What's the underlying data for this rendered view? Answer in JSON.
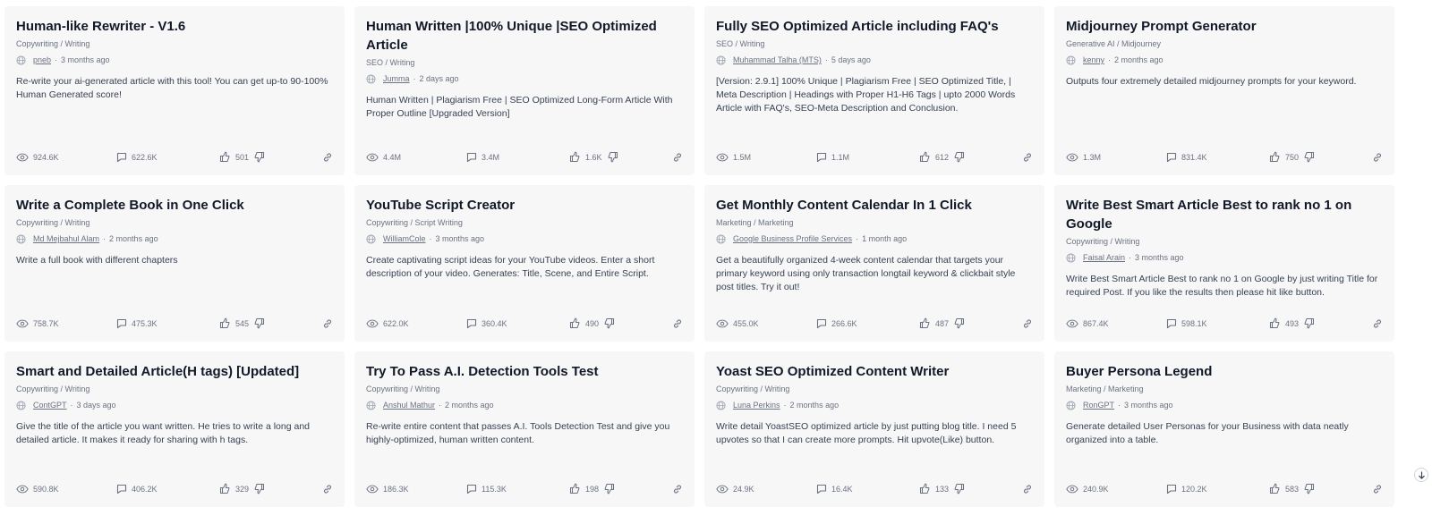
{
  "cards": [
    {
      "title": "Human-like Rewriter - V1.6",
      "category": "Copywriting / Writing",
      "author": "pneb",
      "age": "3 months ago",
      "description": "Re-write your ai-generated article with this tool! You can get up-to 90-100% Human Generated score!",
      "views": "924.6K",
      "comments": "622.6K",
      "likes": "501"
    },
    {
      "title": "Human Written |100% Unique |SEO Optimized Article",
      "category": "SEO / Writing",
      "author": "Jumma",
      "age": "2 days ago",
      "description": "Human Written | Plagiarism Free | SEO Optimized Long-Form Article With Proper Outline [Upgraded Version]",
      "views": "4.4M",
      "comments": "3.4M",
      "likes": "1.6K"
    },
    {
      "title": "Fully SEO Optimized Article including FAQ's",
      "category": "SEO / Writing",
      "author": "Muhammad Talha (MTS)",
      "age": "5 days ago",
      "description": "[Version: 2.9.1] 100% Unique | Plagiarism Free | SEO Optimized Title, | Meta Description | Headings with Proper H1-H6 Tags | upto 2000 Words Article with FAQ's, SEO-Meta Description and Conclusion.",
      "views": "1.5M",
      "comments": "1.1M",
      "likes": "612"
    },
    {
      "title": "Midjourney Prompt Generator",
      "category": "Generative AI / Midjourney",
      "author": "kenny",
      "age": "2 months ago",
      "description": "Outputs four extremely detailed midjourney prompts for your keyword.",
      "views": "1.3M",
      "comments": "831.4K",
      "likes": "750"
    },
    {
      "title": "Write a Complete Book in One Click",
      "category": "Copywriting / Writing",
      "author": "Md Mejbahul Alam",
      "age": "2 months ago",
      "description": "Write a full book with different chapters",
      "views": "758.7K",
      "comments": "475.3K",
      "likes": "545"
    },
    {
      "title": "YouTube Script Creator",
      "category": "Copywriting / Script Writing",
      "author": "WilliamCole",
      "age": "3 months ago",
      "description": "Create captivating script ideas for your YouTube videos. Enter a short description of your video. Generates: Title, Scene, and Entire Script.",
      "views": "622.0K",
      "comments": "360.4K",
      "likes": "490"
    },
    {
      "title": "Get Monthly Content Calendar In 1 Click",
      "category": "Marketing / Marketing",
      "author": "Google Business Profile Services",
      "age": "1 month ago",
      "description": "Get a beautifully organized 4-week content calendar that targets your primary keyword using only transaction longtail keyword & clickbait style post titles. Try it out!",
      "views": "455.0K",
      "comments": "266.6K",
      "likes": "487"
    },
    {
      "title": "Write Best Smart Article Best to rank no 1 on Google",
      "category": "Copywriting / Writing",
      "author": "Faisal Arain",
      "age": "3 months ago",
      "description": "Write Best Smart Article Best to rank no 1 on Google by just writing Title for required Post. If you like the results then please hit like button.",
      "views": "867.4K",
      "comments": "598.1K",
      "likes": "493"
    },
    {
      "title": "Smart and Detailed Article(H tags) [Updated]",
      "category": "Copywriting / Writing",
      "author": "ContGPT",
      "age": "3 days ago",
      "description": "Give the title of the article you want written. He tries to write a long and detailed article. It makes it ready for sharing with h tags.",
      "views": "590.8K",
      "comments": "406.2K",
      "likes": "329"
    },
    {
      "title": "Try To Pass A.I. Detection Tools Test",
      "category": "Copywriting / Writing",
      "author": "Anshul Mathur",
      "age": "2 months ago",
      "description": "Re-write entire content that passes A.I. Tools Detection Test and give you highly-optimized, human written content.",
      "views": "186.3K",
      "comments": "115.3K",
      "likes": "198"
    },
    {
      "title": "Yoast SEO Optimized Content Writer",
      "category": "Copywriting / Writing",
      "author": "Luna Perkins",
      "age": "2 months ago",
      "description": "Write detail YoastSEO optimized article by just putting blog title. I need 5 upvotes so that I can create more prompts. Hit upvote(Like) button.",
      "views": "24.9K",
      "comments": "16.4K",
      "likes": "133"
    },
    {
      "title": "Buyer Persona Legend",
      "category": "Marketing / Marketing",
      "author": "RonGPT",
      "age": "3 months ago",
      "description": "Generate detailed User Personas for your Business with data neatly organized into a table.",
      "views": "240.9K",
      "comments": "120.2K",
      "likes": "583"
    }
  ]
}
